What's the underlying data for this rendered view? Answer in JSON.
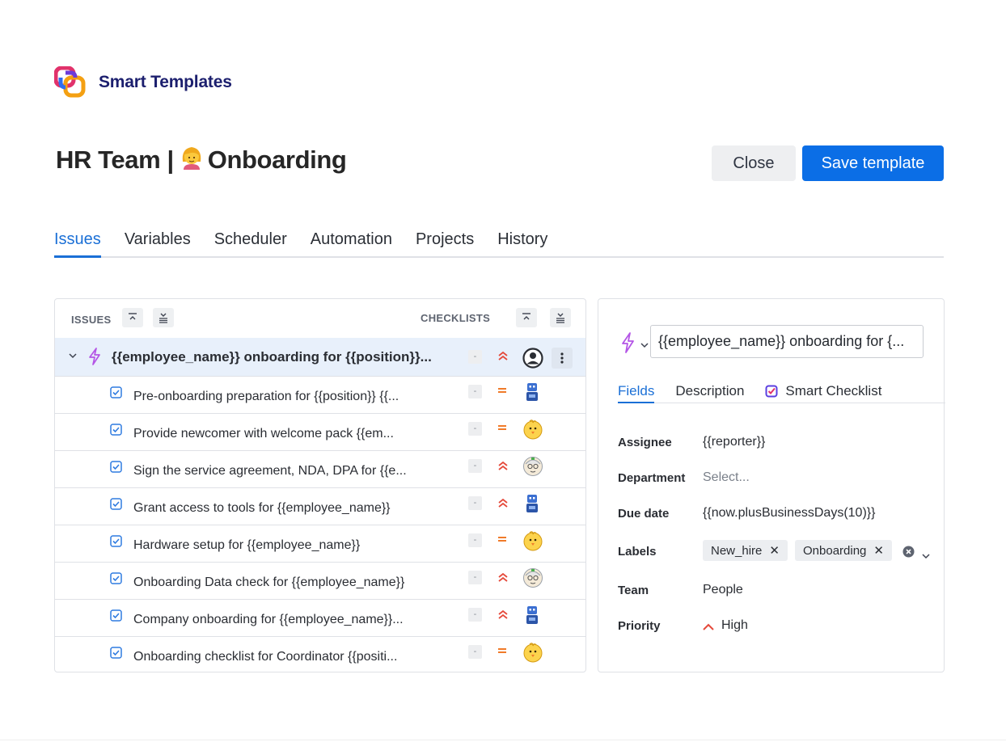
{
  "brand": {
    "name": "Smart Templates",
    "logo_icon": "smart-templates-logo-icon"
  },
  "page": {
    "title_prefix": "HR Team |",
    "title_emoji": "👩",
    "title_suffix": "Onboarding"
  },
  "actions": {
    "close_label": "Close",
    "save_label": "Save template"
  },
  "tabs": [
    {
      "label": "Issues",
      "active": true
    },
    {
      "label": "Variables",
      "active": false
    },
    {
      "label": "Scheduler",
      "active": false
    },
    {
      "label": "Automation",
      "active": false
    },
    {
      "label": "Projects",
      "active": false
    },
    {
      "label": "History",
      "active": false
    }
  ],
  "issues_panel": {
    "issues_label": "ISSUES",
    "checklists_label": "CHECKLISTS",
    "parent": {
      "title": "{{employee_name}} onboarding for {{position}}...",
      "dash": "-",
      "priority_icon": "priority-highest-icon",
      "avatar_icon": "user-avatar-icon"
    },
    "children": [
      {
        "title": "Pre-onboarding preparation for {{position}} {{...",
        "dash": "-",
        "priority": "medium",
        "avatar": "robot-avatar-icon"
      },
      {
        "title": "Provide newcomer with welcome pack {{em...",
        "dash": "-",
        "priority": "medium",
        "avatar": "chick-avatar-icon"
      },
      {
        "title": "Sign the service agreement, NDA, DPA for {{e...",
        "dash": "-",
        "priority": "highest",
        "avatar": "scientist-avatar-icon"
      },
      {
        "title": "Grant access to tools for {{employee_name}}",
        "dash": "-",
        "priority": "highest",
        "avatar": "robot-avatar-icon"
      },
      {
        "title": "Hardware setup for {{employee_name}}",
        "dash": "-",
        "priority": "medium",
        "avatar": "chick-avatar-icon"
      },
      {
        "title": "Onboarding Data check for {{employee_name}}",
        "dash": "-",
        "priority": "highest",
        "avatar": "scientist-avatar-icon"
      },
      {
        "title": "Company onboarding for {{employee_name}}...",
        "dash": "-",
        "priority": "highest",
        "avatar": "robot-avatar-icon"
      },
      {
        "title": "Onboarding checklist for Coordinator {{positi...",
        "dash": "-",
        "priority": "medium",
        "avatar": "chick-avatar-icon"
      }
    ]
  },
  "detail": {
    "summary_value": "{{employee_name}} onboarding for {...",
    "tabs": [
      {
        "label": "Fields",
        "active": true
      },
      {
        "label": "Description",
        "active": false
      },
      {
        "label": "Smart Checklist",
        "active": false,
        "icon": "smart-checklist-icon"
      }
    ],
    "fields": {
      "assignee_label": "Assignee",
      "assignee_value": "{{reporter}}",
      "department_label": "Department",
      "department_placeholder": "Select...",
      "due_date_label": "Due date",
      "due_date_value": "{{now.plusBusinessDays(10)}}",
      "labels_label": "Labels",
      "labels": [
        "New_hire",
        "Onboarding"
      ],
      "label_remove": "✕",
      "team_label": "Team",
      "team_value": "People",
      "priority_label": "Priority",
      "priority_value": "High"
    }
  },
  "colors": {
    "accent": "#0b6ee6",
    "brand_text": "#1c1f6e",
    "priority_high": "#e5493a",
    "priority_medium": "#f07b2a",
    "bolt": "#b455e6",
    "selected_row": "#e8f0fb"
  }
}
